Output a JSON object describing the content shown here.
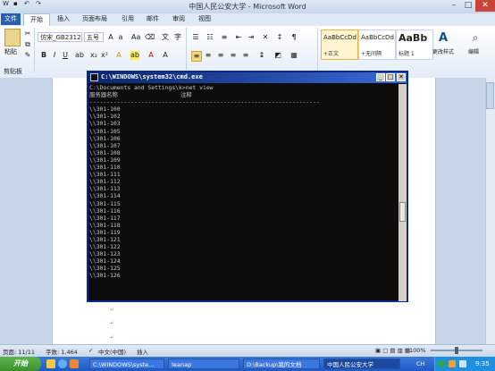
{
  "window": {
    "title": "中国人民公安大学 - Microsoft Word"
  },
  "quick_access": {
    "save_icon": "save-icon",
    "undo_icon": "undo-icon",
    "redo_icon": "redo-icon"
  },
  "tabs": [
    "文件",
    "开始",
    "插入",
    "页面布局",
    "引用",
    "邮件",
    "审阅",
    "视图"
  ],
  "ribbon": {
    "paste_label": "粘贴",
    "clipboard_label": "剪贴板",
    "font_name": "仿宋_GB2312",
    "font_size": "五号",
    "styles": [
      {
        "sample": "AaBbCcDd",
        "label": "+正文"
      },
      {
        "sample": "AaBbCcDd",
        "label": "+无间隔"
      },
      {
        "sample": "AaBb",
        "label": "标题 1"
      }
    ],
    "change_styles_label": "更改样式",
    "edit_label": "编辑"
  },
  "cmd": {
    "title": "C:\\WINDOWS\\system32\\cmd.exe",
    "prompt_line": "C:\\Documents and Settings\\k>net view",
    "header_name": "服务器名称",
    "header_comment": "注释",
    "divider": "-------------------------------------------------------------------",
    "servers": [
      "\\\\301-100",
      "\\\\301-102",
      "\\\\301-103",
      "\\\\301-105",
      "\\\\301-106",
      "\\\\301-107",
      "\\\\301-108",
      "\\\\301-109",
      "\\\\301-110",
      "\\\\301-111",
      "\\\\301-112",
      "\\\\301-113",
      "\\\\301-114",
      "\\\\301-115",
      "\\\\301-116",
      "\\\\301-117",
      "\\\\301-118",
      "\\\\301-119",
      "\\\\301-121",
      "\\\\301-122",
      "\\\\301-123",
      "\\\\301-124",
      "\\\\301-125",
      "\\\\301-126"
    ]
  },
  "status": {
    "page": "页面: 11/11",
    "words": "字数: 1,464",
    "lang": "中文(中国)",
    "mode": "插入",
    "zoom": "100%"
  },
  "taskbar": {
    "start": "开始",
    "tasks": [
      "C:\\WINDOWS\\syste...",
      "Ieanap",
      "D:\\Backup\\我的文档",
      "中国人民公安大学"
    ],
    "lang": "CH",
    "clock": "9:35"
  }
}
